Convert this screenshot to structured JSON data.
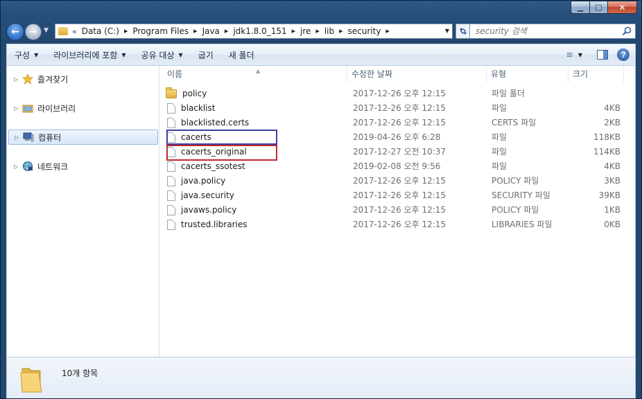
{
  "window": {
    "minimize_glyph": "▁",
    "maximize_glyph": "□",
    "close_glyph": "✕"
  },
  "address": {
    "overflow": "«",
    "crumbs": [
      "Data (C:)",
      "Program Files",
      "Java",
      "jdk1.8.0_151",
      "jre",
      "lib",
      "security"
    ]
  },
  "search": {
    "placeholder": "security 검색"
  },
  "toolbar": {
    "organize": "구성",
    "include_library": "라이브러리에 포함",
    "share": "공유 대상",
    "burn": "굽기",
    "new_folder": "새 폴더"
  },
  "nav": {
    "favorites": "즐겨찾기",
    "libraries": "라이브러리",
    "computer": "컴퓨터",
    "network": "네트워크"
  },
  "columns": {
    "name": "이름",
    "date": "수정한 날짜",
    "type": "유형",
    "size": "크기"
  },
  "files": [
    {
      "name": "policy",
      "date": "2017-12-26 오후 12:15",
      "type": "파일 폴더",
      "size": "",
      "icon": "folder-icon"
    },
    {
      "name": "blacklist",
      "date": "2017-12-26 오후 12:15",
      "type": "파일",
      "size": "4KB",
      "icon": "file-icon"
    },
    {
      "name": "blacklisted.certs",
      "date": "2017-12-26 오후 12:15",
      "type": "CERTS 파일",
      "size": "2KB",
      "icon": "file-icon"
    },
    {
      "name": "cacerts",
      "date": "2019-04-26 오후 6:28",
      "type": "파일",
      "size": "118KB",
      "icon": "file-icon"
    },
    {
      "name": "cacerts_original",
      "date": "2017-12-27 오전 10:37",
      "type": "파일",
      "size": "114KB",
      "icon": "file-icon"
    },
    {
      "name": "cacerts_ssotest",
      "date": "2019-02-08 오전 9:56",
      "type": "파일",
      "size": "4KB",
      "icon": "file-icon"
    },
    {
      "name": "java.policy",
      "date": "2017-12-26 오후 12:15",
      "type": "POLICY 파일",
      "size": "3KB",
      "icon": "file-icon"
    },
    {
      "name": "java.security",
      "date": "2017-12-26 오후 12:15",
      "type": "SECURITY 파일",
      "size": "39KB",
      "icon": "file-icon"
    },
    {
      "name": "javaws.policy",
      "date": "2017-12-26 오후 12:15",
      "type": "POLICY 파일",
      "size": "1KB",
      "icon": "file-icon"
    },
    {
      "name": "trusted.libraries",
      "date": "2017-12-26 오후 12:15",
      "type": "LIBRARIES 파일",
      "size": "0KB",
      "icon": "file-icon"
    }
  ],
  "details": {
    "count_text": "10개 항목"
  },
  "colors": {
    "highlight_blue": "#3c3ca8",
    "highlight_red": "#c0282c"
  }
}
